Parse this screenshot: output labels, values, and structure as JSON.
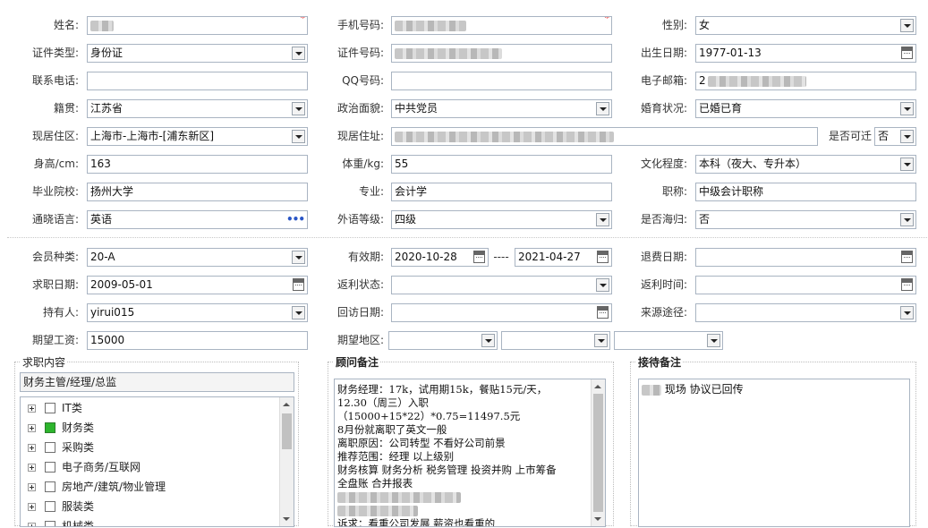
{
  "basic": {
    "name_label": "姓名:",
    "mobile_label": "手机号码:",
    "gender_label": "性别:",
    "gender_value": "女",
    "id_type_label": "证件类型:",
    "id_type_value": "身份证",
    "id_no_label": "证件号码:",
    "birth_label": "出生日期:",
    "birth_value": "1977-01-13",
    "phone_label": "联系电话:",
    "qq_label": "QQ号码:",
    "email_label": "电子邮箱:",
    "email_prefix": "2",
    "native_label": "籍贯:",
    "native_value": "江苏省",
    "political_label": "政治面貌:",
    "political_value": "中共党员",
    "marital_label": "婚育状况:",
    "marital_value": "已婚已育",
    "residence_label": "现居住区:",
    "residence_value": "上海市-上海市-[浦东新区]",
    "address_label": "现居住址:",
    "relocate_label": "是否可迁",
    "relocate_value": "否",
    "height_label": "身高/cm:",
    "height_value": "163",
    "weight_label": "体重/kg:",
    "weight_value": "55",
    "edu_label": "文化程度:",
    "edu_value": "本科（夜大、专升本）",
    "school_label": "毕业院校:",
    "school_value": "扬州大学",
    "major_label": "专业:",
    "major_value": "会计学",
    "title_label": "职称:",
    "title_value": "中级会计职称",
    "lang_label": "通晓语言:",
    "lang_value": "英语",
    "lang_level_label": "外语等级:",
    "lang_level_value": "四级",
    "overseas_label": "是否海归:",
    "overseas_value": "否"
  },
  "member": {
    "type_label": "会员种类:",
    "type_value": "20-A",
    "valid_label": "有效期:",
    "valid_from": "2020-10-28",
    "valid_sep": "----",
    "valid_to": "2021-04-27",
    "refund_date_label": "退费日期:",
    "job_date_label": "求职日期:",
    "job_date_value": "2009-05-01",
    "rebate_status_label": "返利状态:",
    "rebate_time_label": "返利时间:",
    "holder_label": "持有人:",
    "holder_value": "yirui015",
    "visit_date_label": "回访日期:",
    "source_label": "来源途径:",
    "salary_label": "期望工资:",
    "salary_value": "15000",
    "region_label": "期望地区:"
  },
  "job_panel": {
    "title": "求职内容",
    "selected": "财务主管/经理/总监",
    "categories": [
      "IT类",
      "财务类",
      "采购类",
      "电子商务/互联网",
      "房地产/建筑/物业管理",
      "服装类",
      "机械类"
    ],
    "checked_index": 1
  },
  "advisor_panel": {
    "title": "顾问备注",
    "lines": [
      "财务经理：17k，试用期15k，餐贴15元/天，",
      "12.30（周三）入职",
      "（15000+15*22）*0.75=11497.5元",
      "8月份就离职了英文一般",
      "离职原因：公司转型 不看好公司前景",
      "推荐范围：经理 以上级别",
      "财务核算 财务分析 税务管理 投资并购 上市筹备",
      "全盘账 合并报表",
      "",
      "诉求：看重公司发展  薪资也看重的"
    ]
  },
  "reception_panel": {
    "title": "接待备注",
    "text": "现场 协议已回传"
  }
}
